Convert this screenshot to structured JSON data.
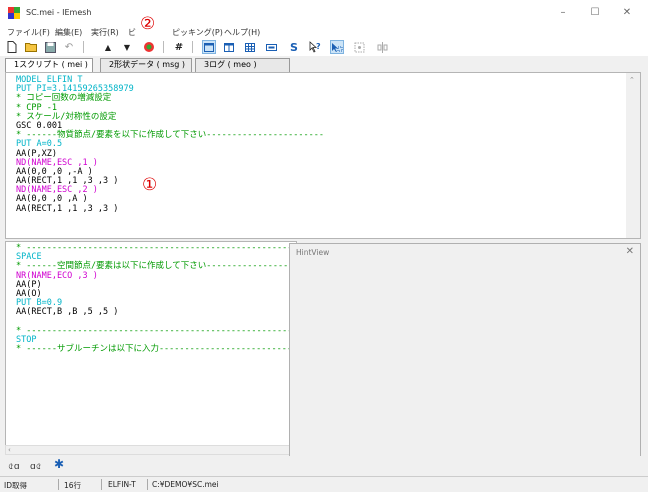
{
  "window": {
    "title": "SC.mei - IEmesh",
    "controls": {
      "minimize": "–",
      "maximize": "☐",
      "close": "✕"
    }
  },
  "menu": [
    {
      "label": "ファイル(F)"
    },
    {
      "label": "編集(E)"
    },
    {
      "label": "実行(R)"
    },
    {
      "label": "ビ"
    },
    {
      "label": "ピッキング(P)"
    },
    {
      "label": "ヘルプ(H)"
    }
  ],
  "markers": {
    "one": "①",
    "two": "②"
  },
  "toolbar": {
    "new": "🗋",
    "open": "📂",
    "save": "💾",
    "undo": "↶",
    "up": "▲",
    "down": "▼",
    "hash": "#",
    "s": "S",
    "help": "?"
  },
  "tabs": [
    {
      "label": "1スクリプト ( mei )",
      "active": true
    },
    {
      "label": "2形状データ ( msg )",
      "active": false
    },
    {
      "label": "3ログ ( meo )",
      "active": false
    }
  ],
  "colors": {
    "cyan": "#00b4c8",
    "magenta": "#d000d0",
    "green": "#009a00",
    "black": "#000000",
    "accent": "#0078d7"
  },
  "editor_top": {
    "lines": [
      {
        "text": "MODEL ELFIN T",
        "color": "cyan"
      },
      {
        "text": "PUT PI=3.14159265358979",
        "color": "cyan"
      },
      {
        "text": "* コピー回数の増減設定",
        "color": "green"
      },
      {
        "text": "* CPP -1",
        "color": "green"
      },
      {
        "text": "* スケール/対称性の設定",
        "color": "green"
      },
      {
        "text": "GSC 0.001",
        "color": "black"
      },
      {
        "text": "* ------物質節点/要素を以下に作成して下さい-----------------------",
        "color": "green"
      },
      {
        "text": "PUT A=0.5",
        "color": "cyan"
      },
      {
        "text": "AA(P,XZ)",
        "color": "black"
      },
      {
        "text": "ND(NAME,ESC ,1 )",
        "color": "magenta"
      },
      {
        "text": "AA(0,0 ,0 ,-A )",
        "color": "black"
      },
      {
        "text": "AA(RECT,1 ,1 ,3 ,3 )",
        "color": "black"
      },
      {
        "text": "ND(NAME,ESC ,2 )",
        "color": "magenta"
      },
      {
        "text": "AA(0,0 ,0 ,A )",
        "color": "black"
      },
      {
        "text": "AA(RECT,1 ,1 ,3 ,3 )",
        "color": "black"
      }
    ]
  },
  "editor_bottom": {
    "lines": [
      {
        "text": "* ------------------------------------------------------------",
        "color": "green"
      },
      {
        "text": "SPACE",
        "color": "cyan"
      },
      {
        "text": "* ------空間節点/要素は以下に作成して下さい---------------------",
        "color": "green"
      },
      {
        "text": "NR(NAME,ECO ,3 )",
        "color": "magenta"
      },
      {
        "text": "AA(P)",
        "color": "black"
      },
      {
        "text": "AA(O)",
        "color": "black"
      },
      {
        "text": "PUT B=0.9",
        "color": "cyan"
      },
      {
        "text": "AA(RECT,B ,B ,5 ,5 )",
        "color": "black"
      },
      {
        "text": "",
        "color": "black"
      },
      {
        "text": "* ------------------------------------------------------------",
        "color": "green"
      },
      {
        "text": "STOP",
        "color": "cyan"
      },
      {
        "text": "* ------サブルーチンは以下に入力----------------------------",
        "color": "green"
      }
    ]
  },
  "hintview": {
    "title": "HintView",
    "close": "✕"
  },
  "bottom_toolbar": {
    "a": "৫ɑ",
    "b": "ɑ৫",
    "c": "✱"
  },
  "status": {
    "mode": "ID取得",
    "line": "16行",
    "model": "ELFIN-T",
    "path": "C:¥DEMO¥SC.mei"
  }
}
